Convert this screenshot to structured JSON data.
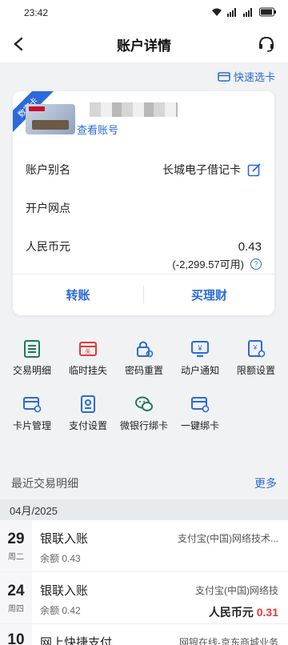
{
  "status_bar": {
    "time": "23:42",
    "icons": [
      "wifi-icon",
      "signal-icon",
      "signal-icon",
      "battery-icon"
    ]
  },
  "header": {
    "title": "账户详情"
  },
  "quick_select": {
    "label": "快速选卡"
  },
  "card": {
    "ribbon": "数字卡",
    "view_account": "查看账号",
    "rows": [
      {
        "label": "账户别名",
        "value": "长城电子借记卡"
      },
      {
        "label": "开户网点",
        "value": ""
      },
      {
        "label": "人民币元",
        "value": "0.43"
      }
    ],
    "available": "(-2,299.57可用)",
    "actions": {
      "transfer": "转账",
      "buy": "买理财"
    }
  },
  "grid": [
    {
      "label": "交易明细",
      "icon": "list-icon"
    },
    {
      "label": "临时挂失",
      "icon": "report-loss-icon"
    },
    {
      "label": "密码重置",
      "icon": "lock-reset-icon"
    },
    {
      "label": "动户通知",
      "icon": "notify-icon"
    },
    {
      "label": "限额设置",
      "icon": "limit-icon"
    },
    {
      "label": "卡片管理",
      "icon": "card-manage-icon"
    },
    {
      "label": "支付设置",
      "icon": "payment-settings-icon"
    },
    {
      "label": "微银行绑卡",
      "icon": "wechat-icon"
    },
    {
      "label": "一键绑卡",
      "icon": "bind-card-icon"
    }
  ],
  "recent": {
    "label": "最近交易明细",
    "more": "更多"
  },
  "month": "04月/2025",
  "transactions": [
    {
      "day": "29",
      "weekday": "周二",
      "title": "银联入账",
      "balance": "余额 0.43",
      "counterparty": "支付宝(中国)网络技术...",
      "amount": ""
    },
    {
      "day": "24",
      "weekday": "周四",
      "title": "银联入账",
      "balance": "余额 0.42",
      "counterparty": "支付宝(中国)网络技",
      "amount_prefix": "人民币元 ",
      "amount": "0.31"
    },
    {
      "day": "10",
      "weekday": "",
      "title": "网上快捷支付",
      "balance": "",
      "counterparty": "网银在线-京东商城业务",
      "amount": ""
    }
  ],
  "colors": {
    "accent": "#2b6ad8",
    "teal": "#1f7a5c",
    "red": "#e23b3b"
  }
}
